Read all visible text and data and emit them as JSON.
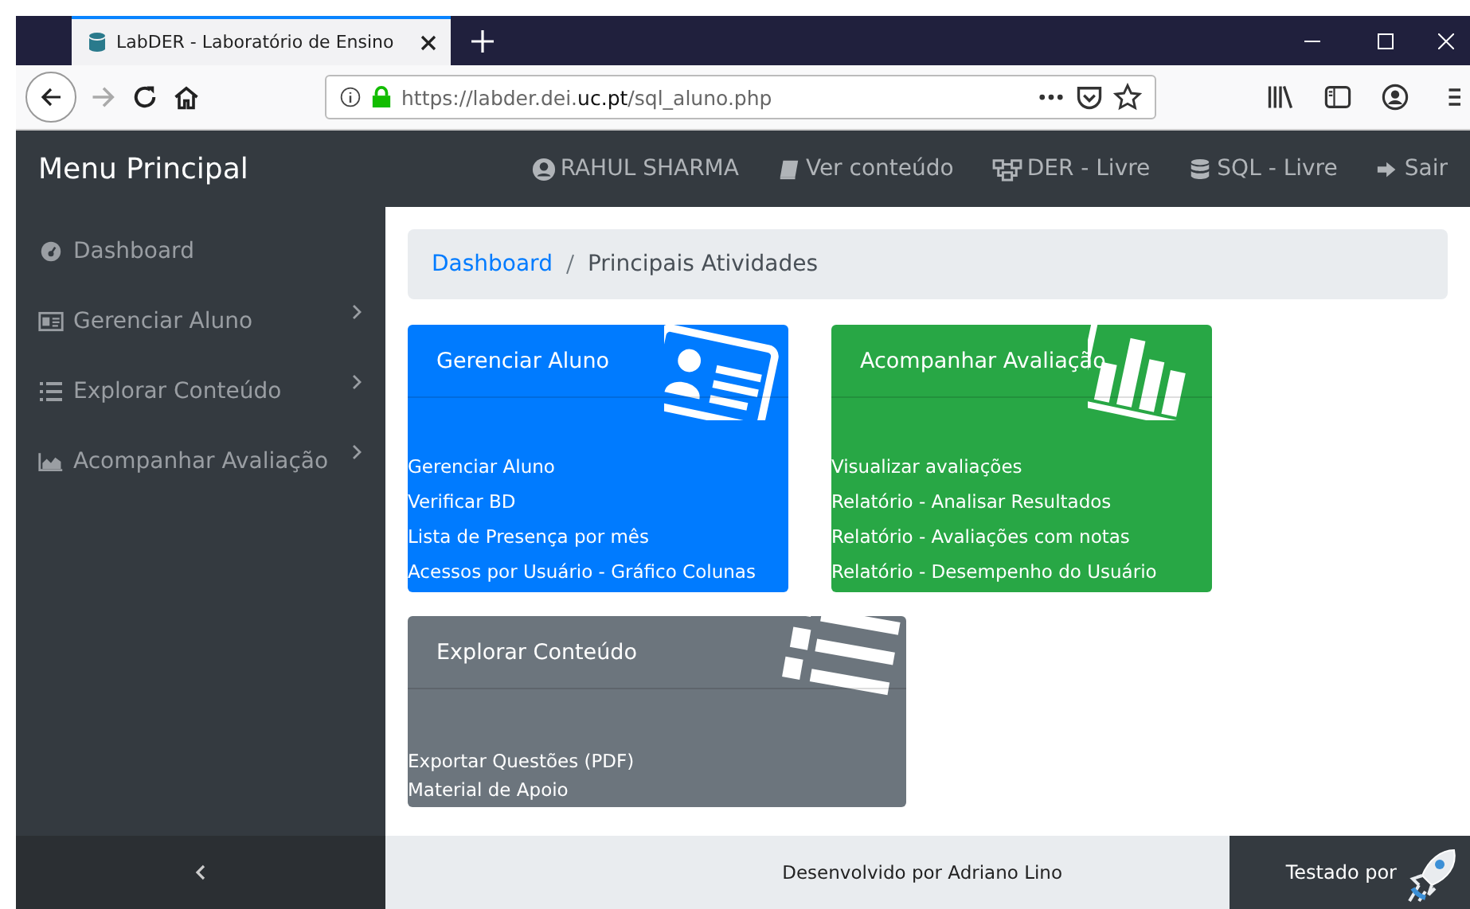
{
  "browser": {
    "tab_title": "LabDER - Laboratório de Ensino",
    "url": "https://labder.dei.**uc.pt**/sql_aluno.php"
  },
  "navbar": {
    "brand": "Menu Principal",
    "links": [
      {
        "label": "RAHUL SHARMA",
        "kind": "user"
      },
      {
        "label": "Ver conteúdo",
        "kind": "book"
      },
      {
        "label": "DER - Livre",
        "kind": "diagram"
      },
      {
        "label": "SQL - Livre",
        "kind": "database"
      },
      {
        "label": "Sair",
        "kind": "exit"
      }
    ]
  },
  "sidebar": {
    "items": [
      {
        "label": "Dashboard",
        "kind": "gauge",
        "expandable": false
      },
      {
        "label": "Gerenciar Aluno",
        "kind": "card",
        "expandable": true
      },
      {
        "label": "Explorar Conteúdo",
        "kind": "list",
        "expandable": true
      },
      {
        "label": "Acompanhar Avaliação",
        "kind": "chart",
        "expandable": true
      }
    ]
  },
  "breadcrumb": [
    {
      "label": "Dashboard",
      "kind": "link"
    },
    {
      "label": "Principais Atividades",
      "kind": "current"
    }
  ],
  "cards": [
    {
      "title": "Gerenciar Aluno",
      "color": "#007bff",
      "kind": "card",
      "links": [
        "Gerenciar Aluno",
        "Verificar BD",
        "Lista de Presença por mês",
        "Acessos por Usuário - Gráfico Colunas"
      ]
    },
    {
      "title": "Acompanhar Avaliação",
      "color": "#28a745",
      "kind": "chart",
      "links": [
        "Visualizar avaliações",
        "Relatório - Analisar Resultados",
        "Relatório - Avaliações com notas",
        "Relatório - Desempenho do Usuário"
      ]
    },
    {
      "title": "Explorar Conteúdo",
      "color": "#6c757d",
      "kind": "list",
      "links": [
        "Exportar Questões (PDF)",
        "Material de Apoio"
      ]
    }
  ],
  "footer": {
    "developed": "Desenvolvido por Adriano Lino",
    "tested": "Testado por"
  }
}
